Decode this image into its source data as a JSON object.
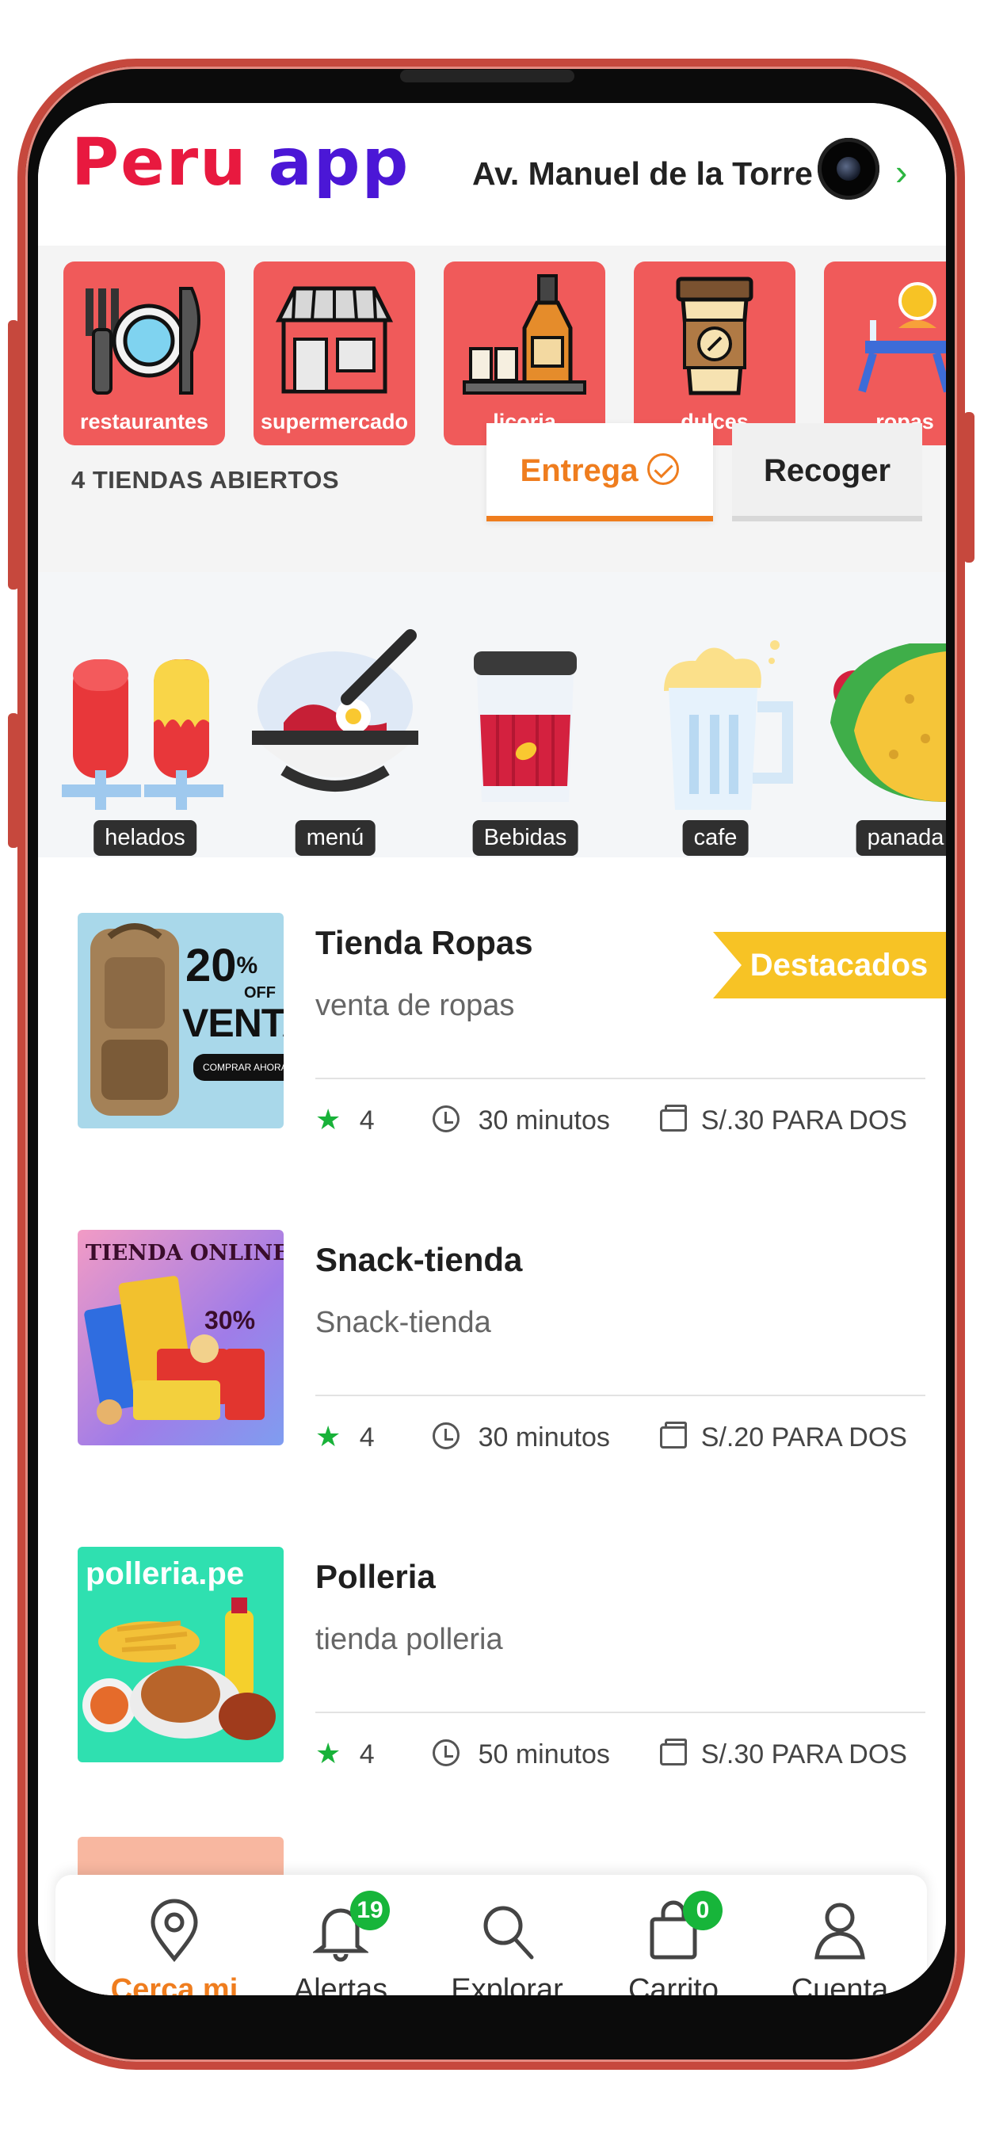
{
  "header": {
    "logo_part1": "Peru",
    "logo_part2": "app",
    "address": "Av. Manuel de la Torre"
  },
  "categories": [
    {
      "label": "restaurantes",
      "icon": "plate-cutlery-icon"
    },
    {
      "label": "supermercado",
      "icon": "store-icon"
    },
    {
      "label": "licoria",
      "icon": "bottle-icon"
    },
    {
      "label": "dulces",
      "icon": "coffee-cup-icon"
    },
    {
      "label": "ropas",
      "icon": "dining-table-icon"
    }
  ],
  "open_stores_label": "4 TIENDAS ABIERTOS",
  "tabs": {
    "delivery": "Entrega",
    "pickup": "Recoger"
  },
  "food_types": [
    {
      "label": "helados",
      "icon": "popsicle-icon"
    },
    {
      "label": "menú",
      "icon": "rice-bowl-icon"
    },
    {
      "label": "Bebidas",
      "icon": "drink-cup-icon"
    },
    {
      "label": "cafe",
      "icon": "beer-mug-icon"
    },
    {
      "label": "panada",
      "icon": "taco-icon"
    }
  ],
  "stores": [
    {
      "name": "Tienda Ropas",
      "desc": "venta de ropas",
      "rating": "4",
      "time": "30 minutos",
      "price": "S/.30 PARA DOS",
      "badge": "Destacados",
      "thumb": {
        "line1": "20",
        "pct": "%",
        "off": "OFF",
        "line2": "VENTA",
        "cta": "COMPRAR AHORA"
      }
    },
    {
      "name": "Snack-tienda",
      "desc": "Snack-tienda",
      "rating": "4",
      "time": "30 minutos",
      "price": "S/.20 PARA DOS",
      "thumb": {
        "line1": "TIENDA ONLINE",
        "line2": "30%"
      }
    },
    {
      "name": "Polleria",
      "desc": "tienda polleria",
      "rating": "4",
      "time": "50 minutos",
      "price": "S/.30 PARA DOS",
      "thumb": {
        "line1": "polleria.pe"
      }
    }
  ],
  "nav": {
    "items": [
      {
        "label": "Cerca mi",
        "icon": "location-pin-icon"
      },
      {
        "label": "Alertas",
        "icon": "bell-icon",
        "count": "19"
      },
      {
        "label": "Explorar",
        "icon": "search-icon"
      },
      {
        "label": "Carrito",
        "icon": "shopping-bag-icon",
        "count": "0"
      },
      {
        "label": "Cuenta",
        "icon": "user-icon"
      }
    ]
  },
  "colors": {
    "accent": "#ef7d1e",
    "category_bg": "#f05a5a",
    "badge": "#f7c325",
    "green": "#17b53a"
  }
}
